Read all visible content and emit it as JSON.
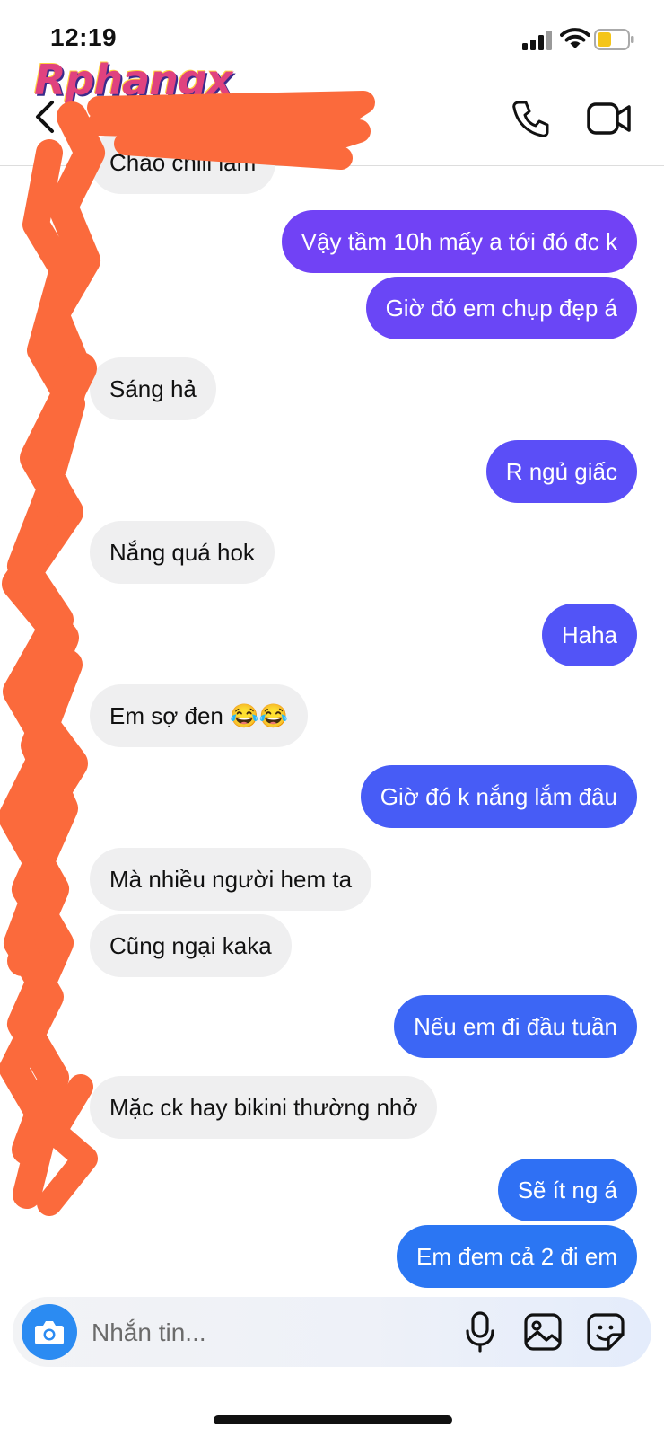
{
  "status_bar": {
    "time": "12:19"
  },
  "watermark": "Rphangx",
  "composer": {
    "placeholder": "Nhắn tin..."
  },
  "messages": [
    {
      "side": "in",
      "text": "Chào chill lắm"
    },
    {
      "side": "out",
      "text": "Vậy tầm 10h mấy a tới đó đc k",
      "color": "#7142f5"
    },
    {
      "side": "out",
      "text": "Giờ đó em chụp đẹp á",
      "color": "#6a46f6"
    },
    {
      "side": "in",
      "text": "Sáng hả"
    },
    {
      "side": "out",
      "text": "R ngủ giấc",
      "color": "#5b4ef7"
    },
    {
      "side": "in",
      "text": "Nắng quá hok"
    },
    {
      "side": "out",
      "text": "Haha",
      "color": "#5254f7"
    },
    {
      "side": "in",
      "text": "Em sợ đen 😂😂"
    },
    {
      "side": "out",
      "text": "Giờ đó k nắng lắm đâu",
      "color": "#475cf6"
    },
    {
      "side": "in",
      "text": "Mà nhiều người hem ta"
    },
    {
      "side": "in",
      "text": "Cũng ngại kaka"
    },
    {
      "side": "out",
      "text": "Nếu em đi đầu tuần",
      "color": "#3c66f5"
    },
    {
      "side": "in",
      "text": "Mặc ck hay bikini thường nhở"
    },
    {
      "side": "out",
      "text": "Sẽ ít ng á",
      "color": "#2f70f4"
    },
    {
      "side": "out",
      "text": "Em đem cả 2 đi em",
      "color": "#2b76f3"
    }
  ]
}
